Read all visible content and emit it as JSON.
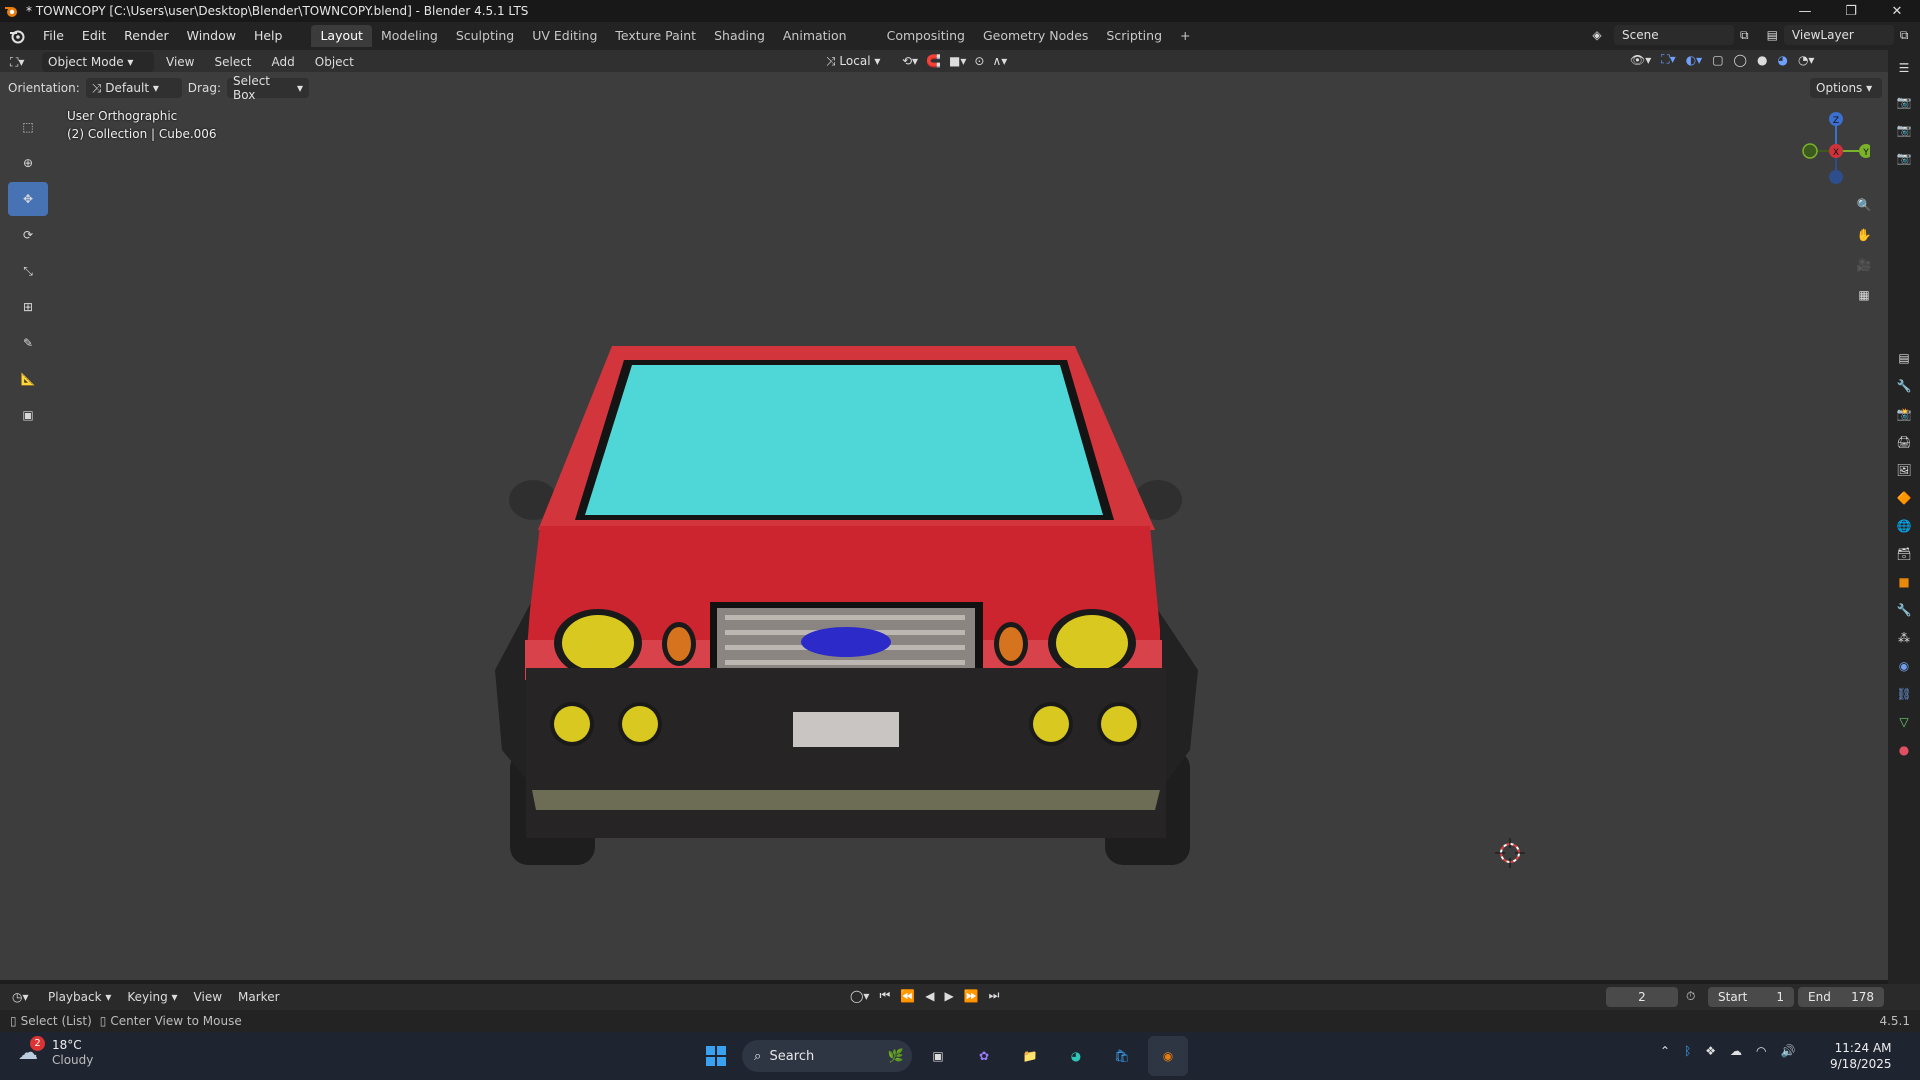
{
  "window": {
    "title": "* TOWNCOPY [C:\\Users\\user\\Desktop\\Blender\\TOWNCOPY.blend] - Blender 4.5.1 LTS",
    "minimize": "—",
    "maximize": "❐",
    "close": "✕"
  },
  "menu": [
    "File",
    "Edit",
    "Render",
    "Window",
    "Help"
  ],
  "workspaces": [
    "Layout",
    "Modeling",
    "Sculpting",
    "UV Editing",
    "Texture Paint",
    "Shading",
    "Animation",
    "Compositing",
    "Geometry Nodes",
    "Scripting"
  ],
  "active_workspace": "Layout",
  "add_workspace": "+",
  "scene": "Scene",
  "view_layer": "ViewLayer",
  "header3d": {
    "mode": "Object Mode",
    "view": "View",
    "select": "Select",
    "add": "Add",
    "object": "Object",
    "transform_orientation": "Local"
  },
  "tool_settings": {
    "orientation_label": "Orientation:",
    "orientation_value": "Default",
    "drag_label": "Drag:",
    "drag_value": "Select Box",
    "options": "Options"
  },
  "viewport": {
    "view_name": "User Orthographic",
    "collection_info": "(2) Collection | Cube.006",
    "gizmo": {
      "z": "Z",
      "x": "X",
      "y": "Y"
    },
    "colors": {
      "background": "#3d3d3d",
      "car_body": "#d32a34",
      "windshield": "#4fd6d6",
      "headlight": "#d8c81f",
      "bumper": "#262424",
      "badge": "#2c2ac8"
    }
  },
  "timeline": {
    "playback": "Playback",
    "keying": "Keying",
    "view": "View",
    "marker": "Marker",
    "current_frame": "2",
    "start_label": "Start",
    "start_value": "1",
    "end_label": "End",
    "end_value": "178"
  },
  "status": {
    "left1": "Select (List)",
    "left2": "Center View to Mouse",
    "version": "4.5.1"
  },
  "taskbar": {
    "weather_badge": "2",
    "temperature": "18°C",
    "condition": "Cloudy",
    "search": "Search",
    "time": "11:24 AM",
    "date": "9/18/2025"
  }
}
